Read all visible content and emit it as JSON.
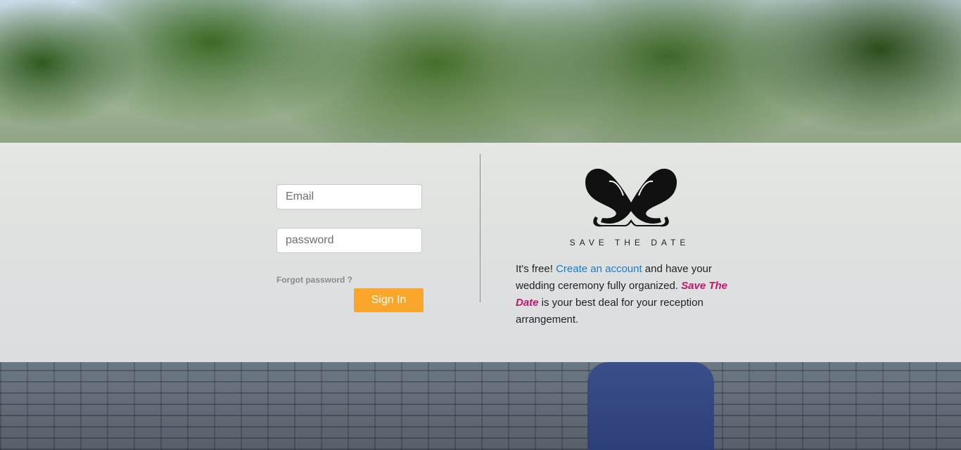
{
  "login": {
    "email_placeholder": "Email",
    "password_placeholder": "password",
    "forgot_label": "Forgot password ?",
    "signin_label": "Sign In"
  },
  "brand": {
    "logo_icon": "save-the-date-logo",
    "name": "SAVE THE DATE"
  },
  "blurb": {
    "part1": "It's free! ",
    "link_label": "Create an account",
    "part2": " and have your wedding ceremony fully organized. ",
    "highlight": "Save The Date",
    "part3": " is your best deal for your reception arrangement."
  },
  "colors": {
    "signin_bg": "#f9a62a",
    "link": "#1a7ac9",
    "highlight": "#c4156c"
  }
}
